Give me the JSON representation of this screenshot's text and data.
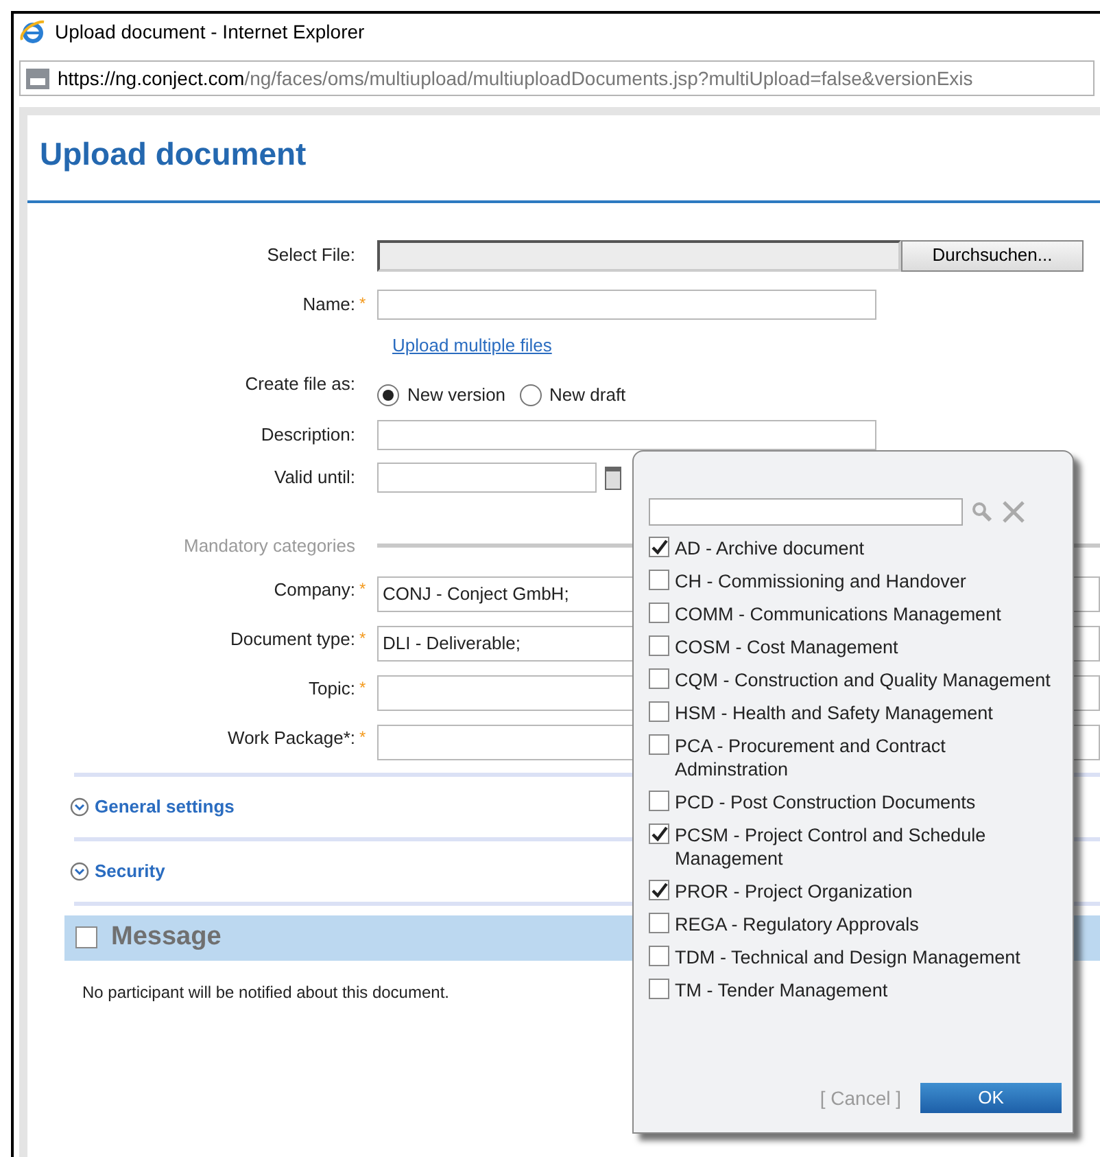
{
  "window": {
    "title": "Upload document - Internet Explorer",
    "url_host_prefix": "https://ng.",
    "url_host": "conject.com",
    "url_path": "/ng/faces/oms/multiupload/multiuploadDocuments.jsp?multiUpload=false&versionExis"
  },
  "page_title": "Upload document",
  "file_select": {
    "label": "Select File:",
    "button": "Durchsuchen..."
  },
  "name_field": {
    "label": "Name:",
    "required_mark": "*"
  },
  "upload_link": "Upload multiple files",
  "create_as": {
    "label": "Create file as:",
    "options": [
      {
        "label": "New version",
        "selected": true
      },
      {
        "label": "New draft",
        "selected": false
      }
    ]
  },
  "description": {
    "label": "Description:"
  },
  "valid_until": {
    "label": "Valid until:"
  },
  "mandatory_heading": "Mandatory categories",
  "categories": [
    {
      "label": "Company:",
      "required_mark": "*",
      "value": "CONJ - Conject GmbH;"
    },
    {
      "label": "Document type:",
      "required_mark": "*",
      "value": "DLI - Deliverable;"
    },
    {
      "label": "Topic:",
      "required_mark": "*"
    },
    {
      "label": "Work Package*:",
      "required_mark": "*"
    }
  ],
  "sections": [
    {
      "title": "General settings",
      "expanded": false
    },
    {
      "title": "Security",
      "expanded": false
    }
  ],
  "message": {
    "title": "Message",
    "checked": false,
    "note": "No participant will be notified about this document."
  },
  "picker": {
    "items": [
      {
        "label": "AD - Archive document",
        "checked": true
      },
      {
        "label": "CH - Commissioning and Handover",
        "checked": false
      },
      {
        "label": "COMM - Communications Management",
        "checked": false
      },
      {
        "label": "COSM - Cost Management",
        "checked": false
      },
      {
        "label": "CQM - Construction and Quality Management",
        "checked": false
      },
      {
        "label": "HSM - Health and Safety Management",
        "checked": false
      },
      {
        "label": "PCA - Procurement and Contract Adminstration",
        "checked": false
      },
      {
        "label": "PCD - Post Construction Documents",
        "checked": false
      },
      {
        "label": "PCSM - Project Control and Schedule Management",
        "checked": true
      },
      {
        "label": "PROR - Project Organization",
        "checked": true
      },
      {
        "label": "REGA - Regulatory Approvals",
        "checked": false
      },
      {
        "label": "TDM - Technical and Design Management",
        "checked": false
      },
      {
        "label": "TM - Tender Management",
        "checked": false
      }
    ],
    "cancel": "[ Cancel ]",
    "ok": "OK"
  }
}
